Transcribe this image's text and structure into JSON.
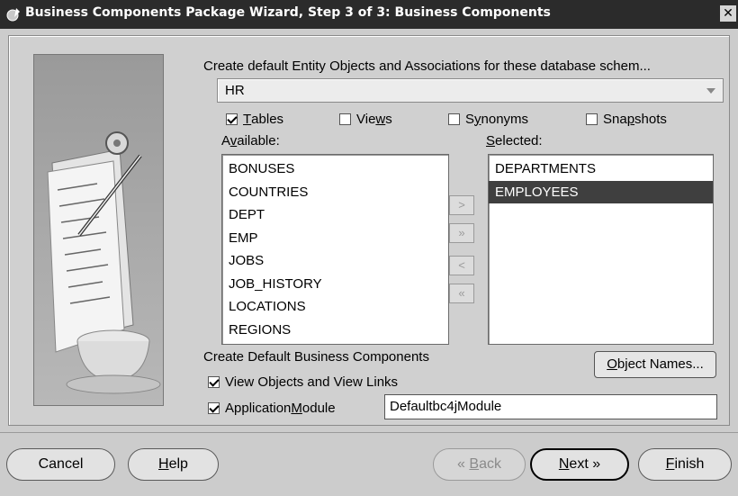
{
  "window": {
    "title": "Business Components Package Wizard, Step 3 of 3: Business Components",
    "close_glyph": "✕",
    "icon": "wizard-icon"
  },
  "schema": {
    "prompt": "Create default Entity Objects and Associations for these database schem...",
    "selected": "HR"
  },
  "object_types": [
    {
      "label_pre": "",
      "label_ul": "T",
      "label_post": "ables",
      "checked": true
    },
    {
      "label_pre": "Vie",
      "label_ul": "w",
      "label_post": "s",
      "checked": false
    },
    {
      "label_pre": "S",
      "label_ul": "y",
      "label_post": "nonyms",
      "checked": false
    },
    {
      "label_pre": "Sna",
      "label_ul": "p",
      "label_post": "shots",
      "checked": false
    }
  ],
  "available": {
    "label_pre": "A",
    "label_ul": "v",
    "label_post": "ailable:",
    "items": [
      "BONUSES",
      "COUNTRIES",
      "DEPT",
      "EMP",
      "JOBS",
      "JOB_HISTORY",
      "LOCATIONS",
      "REGIONS"
    ]
  },
  "selected": {
    "label_pre": "",
    "label_ul": "S",
    "label_post": "elected:",
    "items": [
      "DEPARTMENTS",
      "EMPLOYEES"
    ],
    "highlighted_index": 1
  },
  "shuttle_buttons": [
    {
      "name": "move-right-button",
      "glyph": ">"
    },
    {
      "name": "move-all-right-button",
      "glyph": "»"
    },
    {
      "name": "move-left-button",
      "glyph": "<"
    },
    {
      "name": "move-all-left-button",
      "glyph": "«"
    }
  ],
  "business_components": {
    "heading": "Create Default Business Components",
    "view_objects": {
      "label": "View Objects and View Links",
      "checked": true
    },
    "app_module": {
      "label_pre": "Application ",
      "label_ul": "M",
      "label_post": "odule",
      "checked": true
    },
    "app_module_name": "Defaultbc4jModule"
  },
  "object_names_button": {
    "label_pre": "",
    "label_ul": "O",
    "label_post": "bject Names..."
  },
  "footer": {
    "cancel": "Cancel",
    "help": {
      "ul": "H",
      "rest": "elp"
    },
    "back": {
      "glyph": "«",
      "ul": "B",
      "rest": "ack"
    },
    "next": {
      "ul": "N",
      "rest": "ext",
      "glyph": "»"
    },
    "finish": {
      "ul": "F",
      "rest": "inish"
    }
  },
  "colors": {
    "titlebar": "#2b2b2b",
    "panel": "#d0d0d0",
    "selection": "#3f3f3f"
  }
}
